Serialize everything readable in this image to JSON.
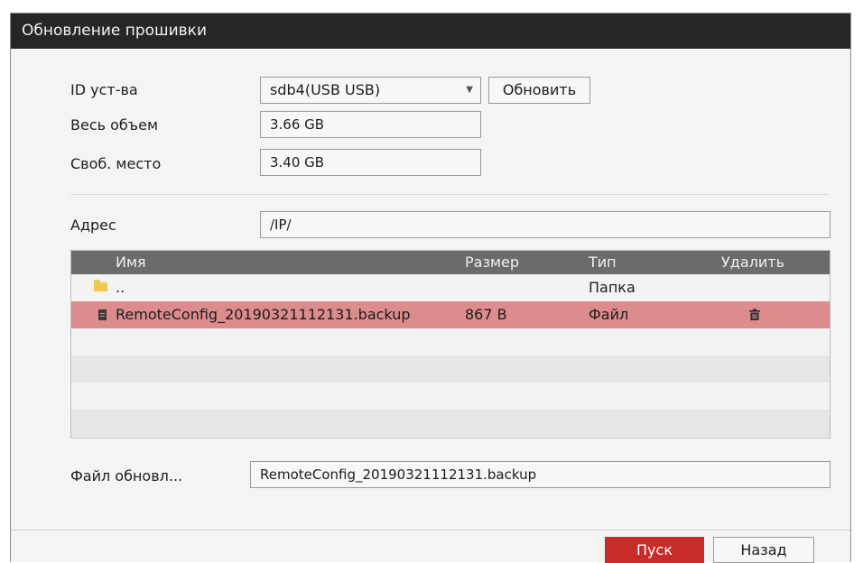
{
  "window": {
    "title": "Обновление прошивки"
  },
  "device": {
    "label": "ID уст-ва",
    "selected": "sdb4(USB USB)",
    "refresh_label": "Обновить"
  },
  "capacity": {
    "total_label": "Весь объем",
    "total_value": "3.66 GB",
    "free_label": "Своб. место",
    "free_value": "3.40 GB"
  },
  "address": {
    "label": "Адрес",
    "value": "/IP/"
  },
  "table": {
    "columns": [
      "Имя",
      "Размер",
      "Тип",
      "Удалить"
    ],
    "rows": [
      {
        "name": "..",
        "size": "",
        "type": "Папка",
        "icon": "folder-icon"
      },
      {
        "name": "RemoteConfig_20190321112131.backup",
        "size": "867 B",
        "type": "Файл",
        "icon": "file-icon",
        "selected": true,
        "delete_icon": "trash-icon"
      }
    ]
  },
  "update_file": {
    "label": "Файл обновл...",
    "value": "RemoteConfig_20190321112131.backup"
  },
  "footer": {
    "start_label": "Пуск",
    "back_label": "Назад"
  },
  "colors": {
    "titlebar": "#262626",
    "selected_row": "#dc8c8c",
    "primary_button": "#c92a2a",
    "header": "#6b6b6b"
  }
}
